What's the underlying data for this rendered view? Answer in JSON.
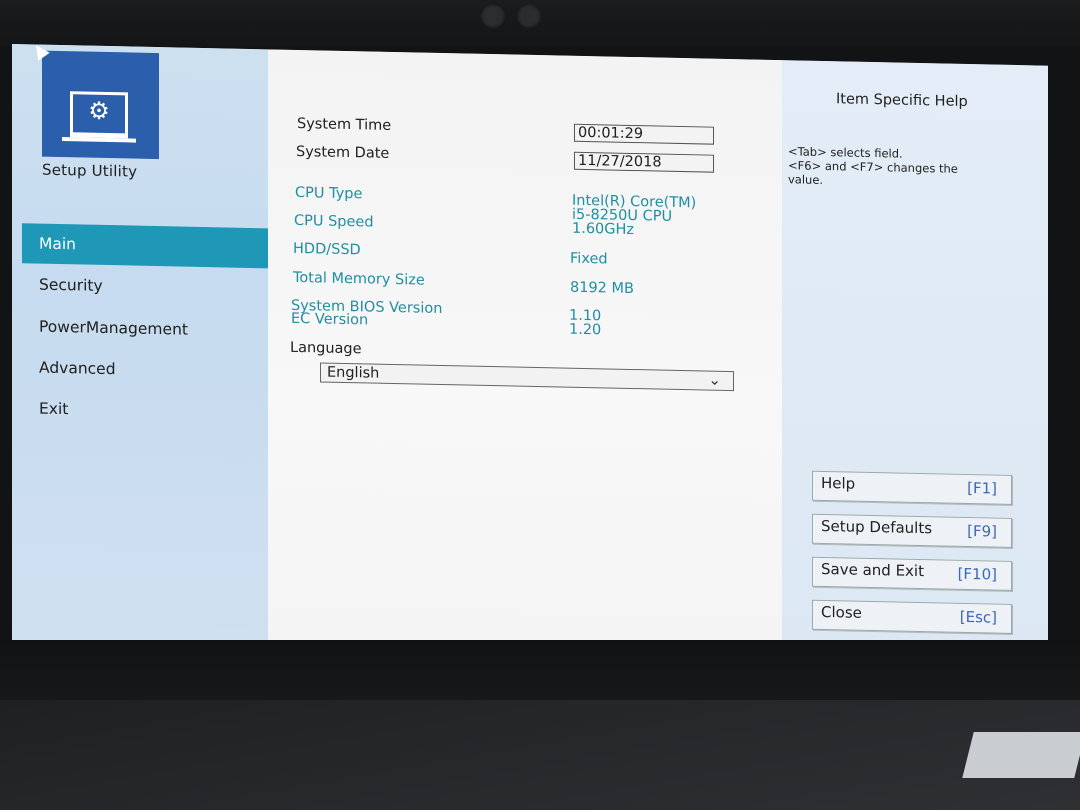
{
  "nav": {
    "title": "Setup Utility",
    "items": [
      {
        "label": "Main",
        "active": true
      },
      {
        "label": "Security",
        "active": false
      },
      {
        "label": "PowerManagement",
        "active": false
      },
      {
        "label": "Advanced",
        "active": false
      },
      {
        "label": "Exit",
        "active": false
      }
    ]
  },
  "main": {
    "system_time": {
      "label": "System Time",
      "value": "00:01:29"
    },
    "system_date": {
      "label": "System Date",
      "value": "11/27/2018"
    },
    "cpu_type": {
      "label": "CPU Type",
      "value_lines": [
        "Intel(R) Core(TM)",
        "i5-8250U CPU",
        "1.60GHz"
      ]
    },
    "cpu_speed": {
      "label": "CPU Speed"
    },
    "hdd_ssd": {
      "label": "HDD/SSD",
      "value": "Fixed"
    },
    "total_memory": {
      "label": "Total Memory Size",
      "value": "8192 MB"
    },
    "bios_version": {
      "label": "System BIOS Version",
      "value": "1.10"
    },
    "ec_version": {
      "label": "EC Version",
      "value": "1.20"
    },
    "language": {
      "label": "Language",
      "selected": "English"
    }
  },
  "help": {
    "title": "Item Specific Help",
    "text_lines": [
      "<Tab> selects field.",
      "<F6> and <F7> changes the",
      "value."
    ],
    "buttons": [
      {
        "label": "Help",
        "key": "[F1]"
      },
      {
        "label": "Setup Defaults",
        "key": "[F9]"
      },
      {
        "label": "Save and Exit",
        "key": "[F10]"
      },
      {
        "label": "Close",
        "key": "[Esc]"
      }
    ]
  },
  "colors": {
    "nav_active": "#1f97b7",
    "logo_blue": "#2b5eab",
    "value_teal": "#1f8ea0",
    "key_blue": "#3a68b8"
  },
  "icons": {
    "logo": "gear-monitor-icon",
    "dropdown": "chevron-down-icon"
  }
}
